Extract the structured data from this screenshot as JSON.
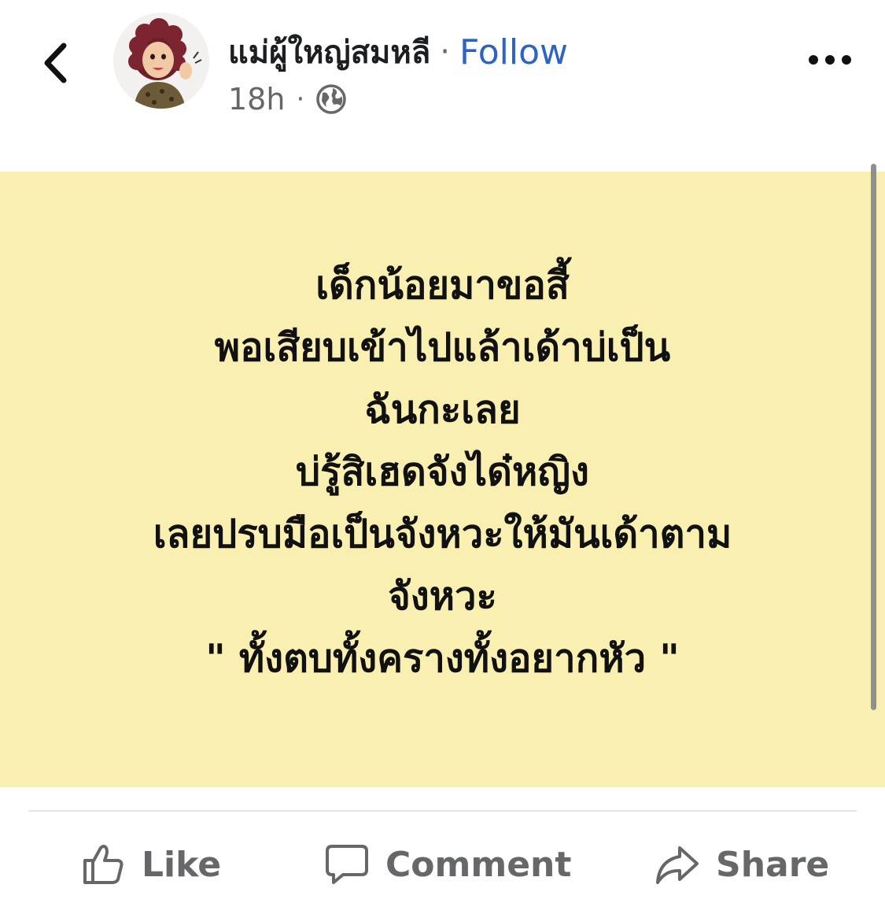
{
  "header": {
    "author_name": "แม่ผู้ใหญ่สมหลี",
    "separator": "·",
    "follow_label": "Follow",
    "timestamp": "18h",
    "meta_separator": "·",
    "privacy_icon": "globe-icon",
    "back_icon": "chevron-left-icon",
    "more_icon": "more-horizontal-icon"
  },
  "post": {
    "background_color": "#f8efb0",
    "lines": [
      "เด็กน้อยมาขอสี้",
      "พอเสียบเข้าไปแล้าเด้าบ่เป็น",
      "ฉันกะเลย",
      "บ่รู้สิเฮดจังได๋หญิง",
      "เลยปรบมือเป็นจังหวะให้มันเด้าตาม",
      "จังหวะ",
      "\" ทั้งตบทั้งครางทั้งอยากหัว \""
    ]
  },
  "actions": {
    "like": {
      "label": "Like",
      "icon": "thumbs-up-icon"
    },
    "comment": {
      "label": "Comment",
      "icon": "comment-bubble-icon"
    },
    "share": {
      "label": "Share",
      "icon": "share-arrow-icon"
    }
  },
  "colors": {
    "follow": "#2d62c7",
    "muted_text": "#65676b",
    "primary_text": "#1c1e21",
    "divider": "#e4e6eb"
  }
}
